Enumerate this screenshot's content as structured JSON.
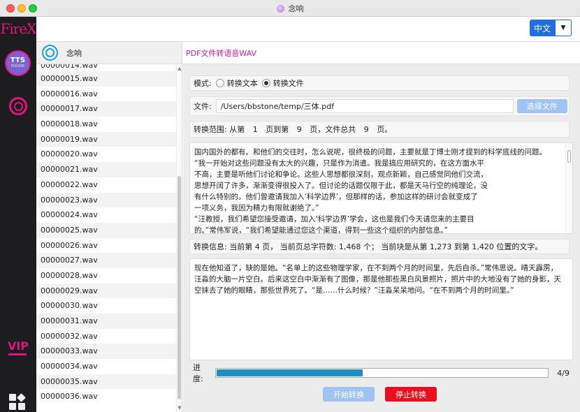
{
  "window": {
    "title": "念响"
  },
  "sidebar": {
    "logo": "FireX",
    "tts_label": "TTS",
    "tts_sub": "ENGINE",
    "vip_label": "VIP"
  },
  "header": {
    "lang_label": "中文",
    "lang_arrow": "▼"
  },
  "file_panel": {
    "title": "念响",
    "items": [
      "00000014.wav",
      "00000015.wav",
      "00000016.wav",
      "00000017.wav",
      "00000018.wav",
      "00000019.wav",
      "00000020.wav",
      "00000021.wav",
      "00000022.wav",
      "00000023.wav",
      "00000024.wav",
      "00000025.wav",
      "00000026.wav",
      "00000027.wav",
      "00000028.wav",
      "00000029.wav",
      "00000030.wav",
      "00000031.wav",
      "00000032.wav",
      "00000033.wav",
      "00000034.wav",
      "00000035.wav",
      "00000036.wav"
    ]
  },
  "main": {
    "title": "PDF文件转语音WAV",
    "mode_label": "模式:",
    "mode_text": "转换文本",
    "mode_file": "转换文件",
    "file_label": "文件:",
    "file_path": "/Users/bbstone/temp/三体.pdf",
    "select_file": "选择文件",
    "range": {
      "label": "转换范围: 从第",
      "from": "1",
      "mid": "页到第",
      "to": "9",
      "mid2": "页，文件总共",
      "total": "9",
      "end": "页。"
    },
    "source_lines": [
      "国内国外的都有。和他们的交往时，怎么说呢，很终极的问题，主要就是丁博士刚才提到的科学底线的问题。",
      "“我一开始对这些问题没有太大的兴趣，只是作为消遣。我是搞应用研究的，在这方面水平",
      "不高，主要是听他们讨论和争论。这些人思想都很深刻，观点新颖，自己感觉同他们交流，",
      "思想开阔了许多，渐渐变得很投入了。但讨论的话题仅限于此，都是天马行空的纯理论，没",
      "有什么特别的。他们曾邀请我加入‘科学边界’，但那样的话，参加这样的研讨会就变成了",
      "一项义务，我因为精力有限就谢绝了。”",
      "“汪教授，我们希望您接受邀请，加入‘科学边界’学会，这也是我们今天请您来的主要目",
      "的。”常伟军说，“我们希望能通过您这个渠道，得到一些这个组织的内部信息。”"
    ],
    "info": "转换信息:  当前第 4 页， 当前页总字符数: 1,468 个；  当前块是从第 1,273 到第 1,420 位置的文字。",
    "chunk_lines": [
      "现在他知道了，缺的是她。“名单上的这些物理学家，在不到两个月的时间里，先后自杀。”常伟思说。晴天霹雳，",
      "汪淼的大脑一片空白。后来这空白中渐渐有了图像，那是他那些黑白风景照片，照片中的大地没有了她的身影，天",
      "空抹去了她的眼睛，那些世界死了。“是……什么时候？”汪淼呆呆地问。“在不到两个月的时间里。”"
    ],
    "progress_label": "进度:",
    "progress_value": 0.44,
    "progress_text": "4/9",
    "start_button": "开始转换",
    "stop_button": "停止转换"
  }
}
